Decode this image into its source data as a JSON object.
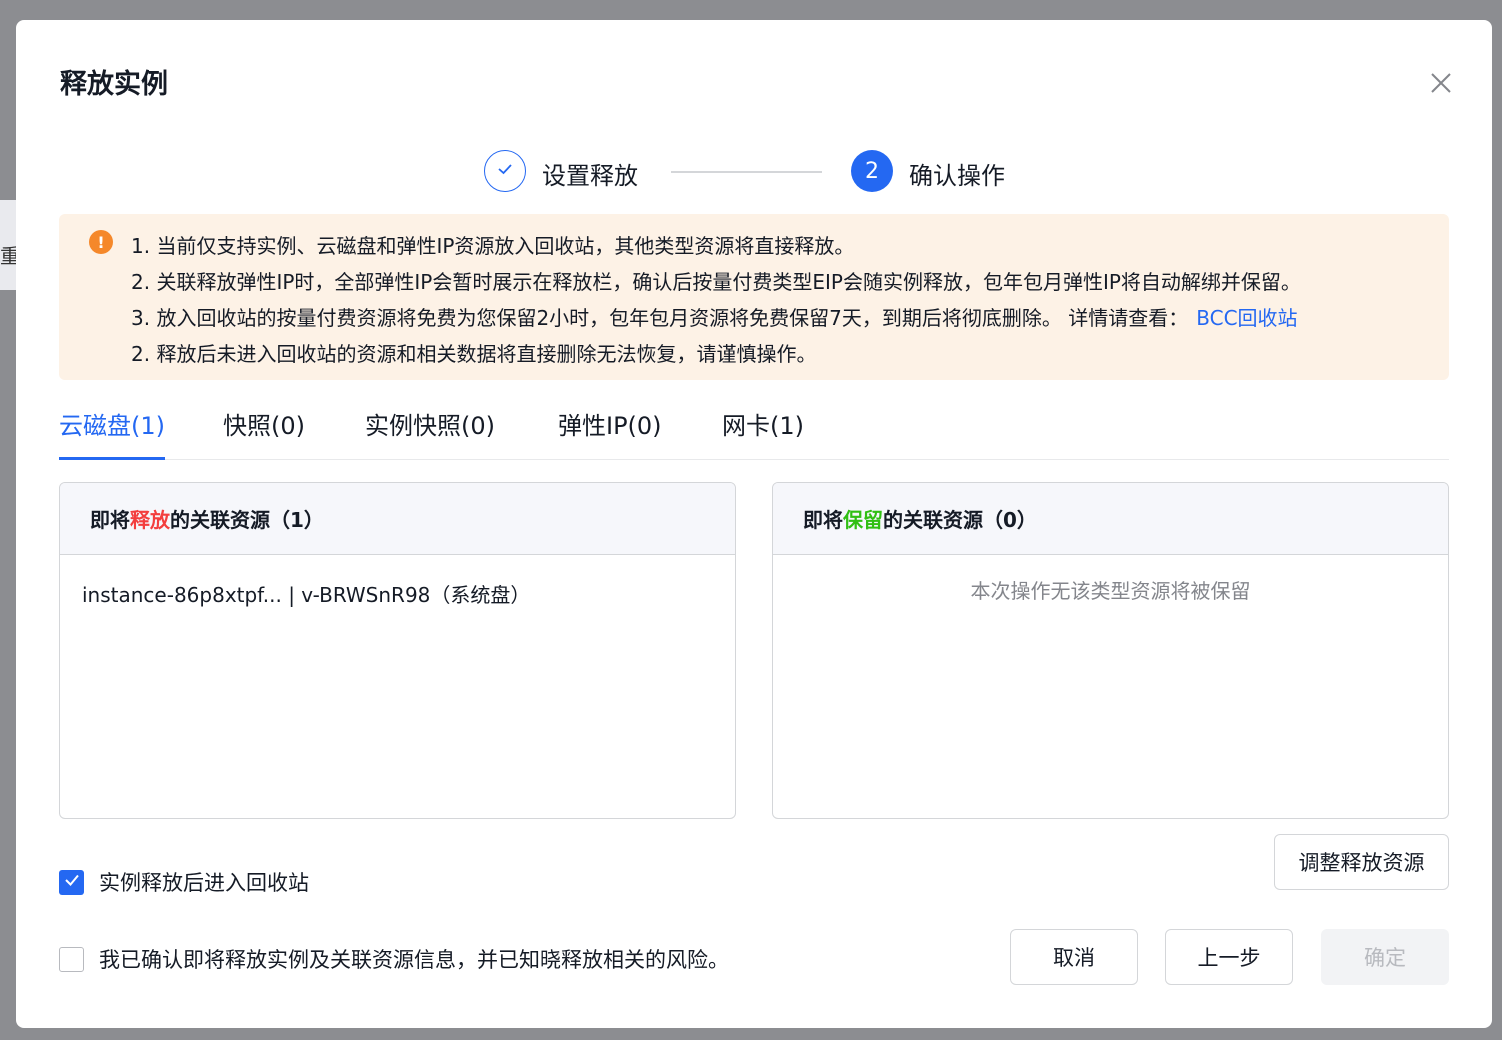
{
  "background": {
    "fragment_text": "重"
  },
  "dialog": {
    "title": "释放实例",
    "close_icon": "close-icon"
  },
  "steps": [
    {
      "number": "",
      "label": "设置释放",
      "status": "done",
      "icon": "check-icon"
    },
    {
      "number": "2",
      "label": "确认操作",
      "status": "active"
    }
  ],
  "notice": {
    "icon": "warning-icon",
    "icon_glyph": "!",
    "lines": [
      "1. 当前仅支持实例、云磁盘和弹性IP资源放入回收站，其他类型资源将直接释放。",
      "2. 关联释放弹性IP时，全部弹性IP会暂时展示在释放栏，确认后按量付费类型EIP会随实例释放，包年包月弹性IP将自动解绑并保留。",
      "3. 放入回收站的按量付费资源将免费为您保留2小时，包年包月资源将免费保留7天，到期后将彻底删除。 详情请查看：",
      "2. 释放后未进入回收站的资源和相关数据将直接删除无法恢复，请谨慎操作。"
    ],
    "link_text": "BCC回收站"
  },
  "tabs": [
    {
      "label": "云磁盘(1)",
      "active": true
    },
    {
      "label": "快照(0)",
      "active": false
    },
    {
      "label": "实例快照(0)",
      "active": false
    },
    {
      "label": "弹性IP(0)",
      "active": false
    },
    {
      "label": "网卡(1)",
      "active": false
    }
  ],
  "release_panel": {
    "title_prefix": "即将",
    "title_highlight": "释放",
    "title_suffix": "的关联资源（1）",
    "items": [
      "instance-86p8xtpf... | v-BRWSnR98（系统盘）"
    ]
  },
  "keep_panel": {
    "title_prefix": "即将",
    "title_highlight": "保留",
    "title_suffix": "的关联资源（0）",
    "empty_text": "本次操作无该类型资源将被保留"
  },
  "adjust_button": "调整释放资源",
  "recycle_checkbox": {
    "label": "实例释放后进入回收站",
    "checked": true
  },
  "confirm_checkbox": {
    "label": "我已确认即将释放实例及关联资源信息，并已知晓释放相关的风险。",
    "checked": false
  },
  "footer": {
    "cancel": "取消",
    "prev": "上一步",
    "confirm": "确定",
    "confirm_disabled": true
  },
  "colors": {
    "primary": "#2468f2",
    "warning": "#f5882a",
    "release_red": "#f33e3e",
    "keep_green": "#30bf13",
    "notice_bg": "#fdf2e6",
    "overlay": "#8c8d91"
  }
}
